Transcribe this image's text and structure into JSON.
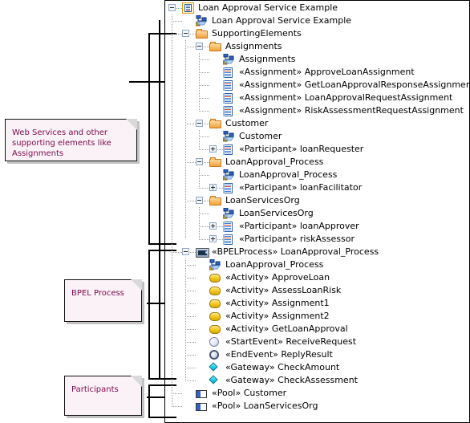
{
  "diagram": {
    "title": "Loan Approval Service Example",
    "accent_folder": "#f1a33c",
    "accent_activity": "#f2c516",
    "accent_gateway": "#16d6ef",
    "note_text_color": "#7a0a4f"
  },
  "notes": [
    {
      "id": "note-supporting",
      "text": "Web Services and other supporting elements like Assignments"
    },
    {
      "id": "note-bpel",
      "text": "BPEL Process"
    },
    {
      "id": "note-participants",
      "text": "Participants"
    }
  ],
  "tree": {
    "rows": [
      {
        "label": "Loan Approval Service Example",
        "icon": "model-root-icon",
        "expander": "minus",
        "depth": 0
      },
      {
        "label": "Loan Approval Service Example",
        "icon": "diagram-icon",
        "expander": "none",
        "depth": 1
      },
      {
        "label": "SupportingElements",
        "icon": "folder-icon",
        "expander": "minus",
        "depth": 1
      },
      {
        "label": "Assignments",
        "icon": "folder-icon",
        "expander": "minus",
        "depth": 2
      },
      {
        "label": "Assignments",
        "icon": "diagram-icon",
        "expander": "none",
        "depth": 3
      },
      {
        "label": "«Assignment» ApproveLoanAssignment",
        "icon": "classifier-icon",
        "expander": "none",
        "depth": 3
      },
      {
        "label": "«Assignment» GetLoanApprovalResponseAssignment",
        "icon": "classifier-icon",
        "expander": "none",
        "depth": 3
      },
      {
        "label": "«Assignment» LoanApprovalRequestAssignment",
        "icon": "classifier-icon",
        "expander": "none",
        "depth": 3
      },
      {
        "label": "«Assignment» RiskAssessmentRequestAssignment",
        "icon": "classifier-icon",
        "expander": "none",
        "depth": 3
      },
      {
        "label": "Customer",
        "icon": "folder-icon",
        "expander": "minus",
        "depth": 2
      },
      {
        "label": "Customer",
        "icon": "diagram-icon",
        "expander": "none",
        "depth": 3
      },
      {
        "label": "«Participant» loanRequester",
        "icon": "classifier-icon",
        "expander": "plus",
        "depth": 3
      },
      {
        "label": "LoanApproval_Process",
        "icon": "folder-icon",
        "expander": "minus",
        "depth": 2
      },
      {
        "label": "LoanApproval_Process",
        "icon": "diagram-icon",
        "expander": "none",
        "depth": 3
      },
      {
        "label": "«Participant» loanFacilitator",
        "icon": "classifier-icon",
        "expander": "plus",
        "depth": 3
      },
      {
        "label": "LoanServicesOrg",
        "icon": "folder-icon",
        "expander": "minus",
        "depth": 2
      },
      {
        "label": "LoanServicesOrg",
        "icon": "diagram-icon",
        "expander": "none",
        "depth": 3
      },
      {
        "label": "«Participant» loanApprover",
        "icon": "classifier-icon",
        "expander": "plus",
        "depth": 3
      },
      {
        "label": "«Participant» riskAssessor",
        "icon": "classifier-icon",
        "expander": "plus",
        "depth": 3
      },
      {
        "label": "«BPELProcess» LoanApproval_Process",
        "icon": "bpel-process-icon",
        "expander": "minus",
        "depth": 1
      },
      {
        "label": "LoanApproval_Process",
        "icon": "diagram-icon",
        "expander": "none",
        "depth": 2
      },
      {
        "label": "«Activity» ApproveLoan",
        "icon": "activity-icon",
        "expander": "none",
        "depth": 2
      },
      {
        "label": "«Activity» AssessLoanRisk",
        "icon": "activity-icon",
        "expander": "none",
        "depth": 2
      },
      {
        "label": "«Activity» Assignment1",
        "icon": "activity-icon",
        "expander": "none",
        "depth": 2
      },
      {
        "label": "«Activity» Assignment2",
        "icon": "activity-icon",
        "expander": "none",
        "depth": 2
      },
      {
        "label": "«Activity» GetLoanApproval",
        "icon": "activity-icon",
        "expander": "none",
        "depth": 2
      },
      {
        "label": "«StartEvent» ReceiveRequest",
        "icon": "start-event-icon",
        "expander": "none",
        "depth": 2
      },
      {
        "label": "«EndEvent» ReplyResult",
        "icon": "end-event-icon",
        "expander": "none",
        "depth": 2
      },
      {
        "label": "«Gateway» CheckAmount",
        "icon": "gateway-icon",
        "expander": "none",
        "depth": 2
      },
      {
        "label": "«Gateway» CheckAssessment",
        "icon": "gateway-icon",
        "expander": "none",
        "depth": 2
      },
      {
        "label": "«Pool» Customer",
        "icon": "pool-icon",
        "expander": "none",
        "depth": 1
      },
      {
        "label": "«Pool» LoanServicesOrg",
        "icon": "pool-icon",
        "expander": "none",
        "depth": 1
      }
    ]
  }
}
